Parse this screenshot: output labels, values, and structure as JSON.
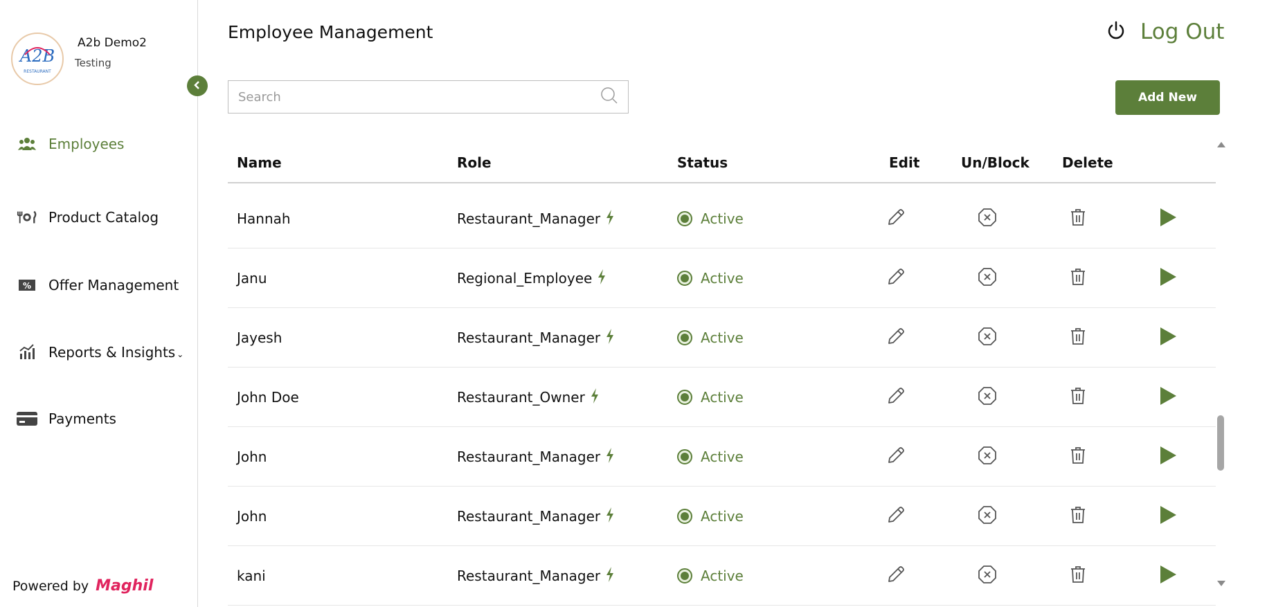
{
  "sidebar": {
    "org_name": "A2b Demo2",
    "org_sub": "Testing",
    "logo_text": "A2B",
    "items": [
      {
        "label": "Employees",
        "icon": "users-icon",
        "active": true
      },
      {
        "label": "Product Catalog",
        "icon": "cutlery-icon",
        "active": false
      },
      {
        "label": "Offer Management",
        "icon": "ticket-percent-icon",
        "active": false
      },
      {
        "label": "Reports & Insights",
        "icon": "bar-chart-icon",
        "active": false
      },
      {
        "label": "Payments",
        "icon": "card-icon",
        "active": false
      }
    ],
    "powered_by": "Powered by",
    "brand": "Maghil"
  },
  "header": {
    "title": "Employee Management",
    "logout_label": "Log Out"
  },
  "search": {
    "placeholder": "Search"
  },
  "add_new_label": "Add New",
  "table": {
    "columns": [
      "Name",
      "Role",
      "Status",
      "Edit",
      "Un/Block",
      "Delete"
    ],
    "rows": [
      {
        "name": "Hannah",
        "role": "Restaurant_Manager",
        "status": "Active"
      },
      {
        "name": "Janu",
        "role": "Regional_Employee",
        "status": "Active"
      },
      {
        "name": "Jayesh",
        "role": "Restaurant_Manager",
        "status": "Active"
      },
      {
        "name": "John Doe",
        "role": "Restaurant_Owner",
        "status": "Active"
      },
      {
        "name": "John",
        "role": "Restaurant_Manager",
        "status": "Active"
      },
      {
        "name": "John",
        "role": "Restaurant_Manager",
        "status": "Active"
      },
      {
        "name": "kani",
        "role": "Restaurant_Manager",
        "status": "Active"
      }
    ]
  },
  "colors": {
    "accent": "#5c7f3a",
    "brand": "#e0245e"
  }
}
